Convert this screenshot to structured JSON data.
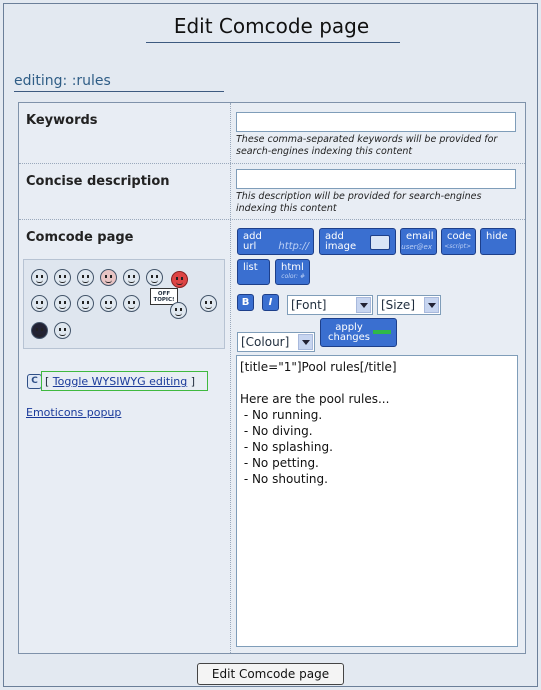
{
  "page": {
    "title": "Edit Comcode page",
    "section": "editing: :rules"
  },
  "fields": {
    "keywords": {
      "label": "Keywords",
      "value": "",
      "help": "These comma-separated keywords will be provided for search-engines indexing this content"
    },
    "description": {
      "label": "Concise description",
      "value": "",
      "help": "This description will be provided for search-engines indexing this content"
    },
    "comcode": {
      "label": "Comcode page",
      "toggle_prefix": "[",
      "toggle_link": "Toggle WYSIWYG editing",
      "toggle_suffix": "]",
      "emoticons_link": "Emoticons popup",
      "off_topic_sign": "OFF TOPIC!",
      "content": "[title=\"1\"]Pool rules[/title]\n\nHere are the pool rules...\n - No running.\n - No diving.\n - No splashing.\n - No petting.\n - No shouting."
    }
  },
  "toolbar": {
    "add_url": "add url",
    "add_url_sub": "http://",
    "add_image": "add image",
    "email": "email",
    "email_sub": "user@ex",
    "code": "code",
    "code_sub": "<script>",
    "hide": "hide",
    "list": "list",
    "html": "html",
    "html_sub": "color: #",
    "bold": "B",
    "italic": "I",
    "font_select": "[Font]",
    "size_select": "[Size]",
    "colour_select": "[Colour]",
    "apply_changes": "apply changes"
  },
  "submit_label": "Edit Comcode page"
}
